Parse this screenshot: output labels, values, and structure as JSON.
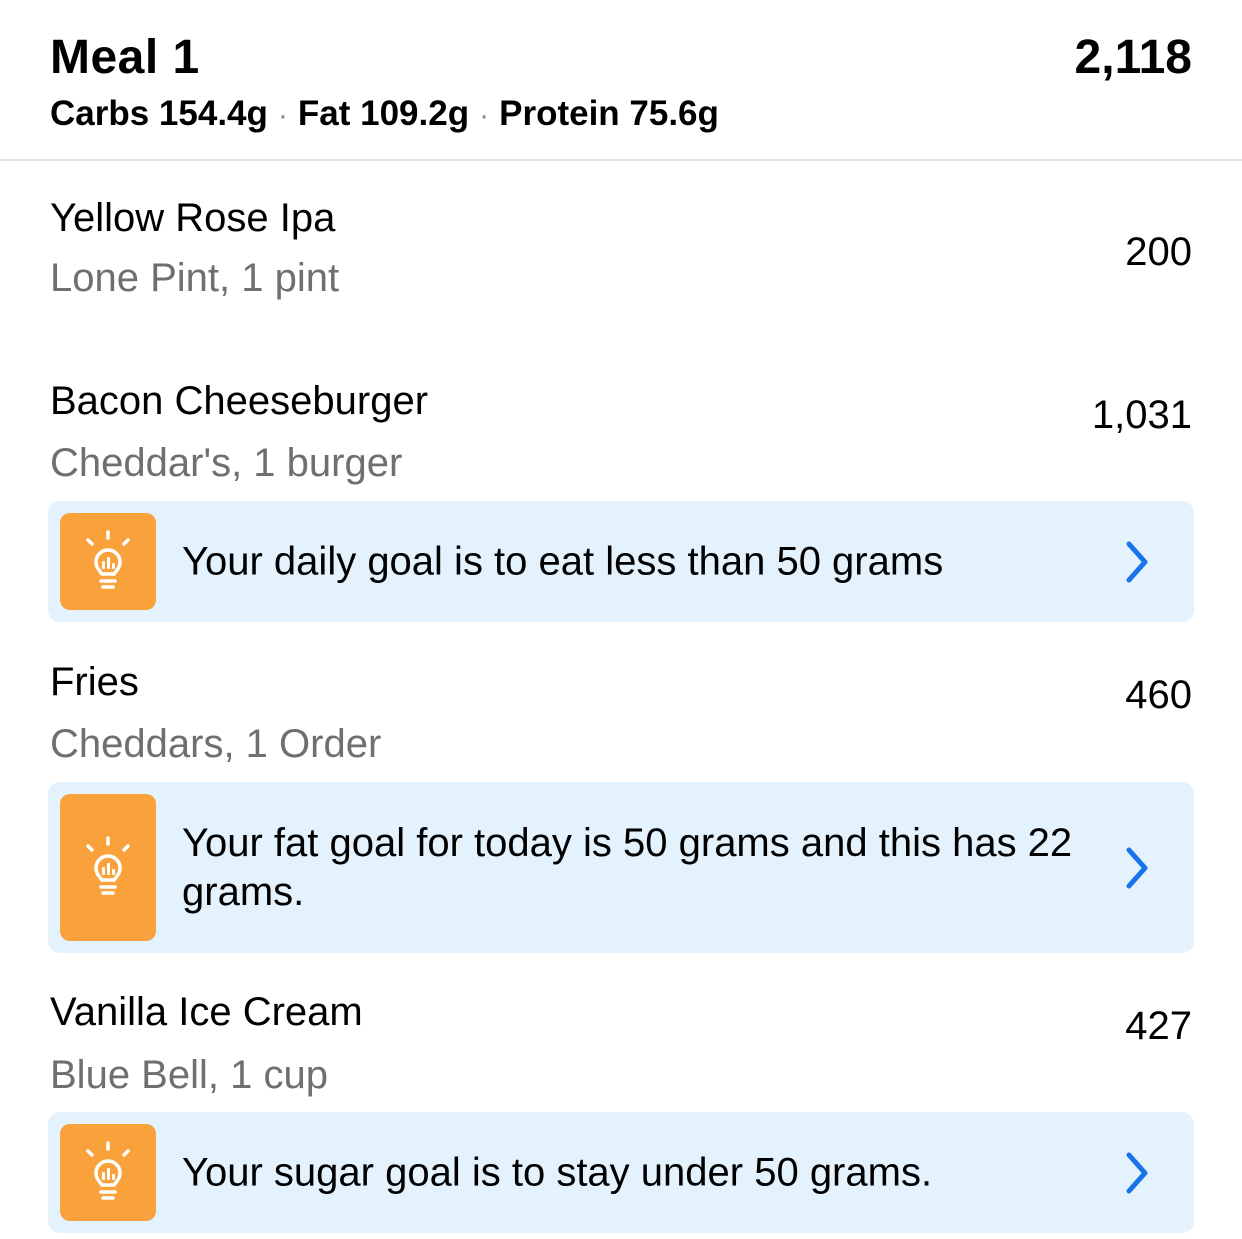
{
  "meal": {
    "title": "Meal 1",
    "total_calories": "2,118",
    "macros": {
      "carbs": "Carbs 154.4g",
      "fat": "Fat 109.2g",
      "protein": "Protein 75.6g",
      "separator": "·"
    }
  },
  "foods": [
    {
      "name": "Yellow Rose Ipa",
      "detail": "Lone Pint, 1 pint",
      "calories": "200"
    },
    {
      "name": "Bacon Cheeseburger",
      "detail": "Cheddar's, 1 burger",
      "calories": "1,031"
    },
    {
      "name": "Fries",
      "detail": "Cheddars, 1 Order",
      "calories": "460"
    },
    {
      "name": "Vanilla Ice Cream",
      "detail": "Blue Bell, 1 cup",
      "calories": "427"
    }
  ],
  "tips": [
    {
      "text": "Your daily goal is to eat less than 50 grams",
      "icon": "lightbulb-chart-icon"
    },
    {
      "text": "Your fat goal for today is 50 grams and this has 22 grams.",
      "icon": "lightbulb-chart-icon"
    },
    {
      "text": "Your sugar goal is to stay under 50 grams.",
      "icon": "lightbulb-chart-icon"
    }
  ],
  "colors": {
    "tip_background": "#e3f2fd",
    "tip_icon_background": "#f9a23b",
    "chevron": "#1a73e8",
    "secondary_text": "#6e6e73"
  }
}
